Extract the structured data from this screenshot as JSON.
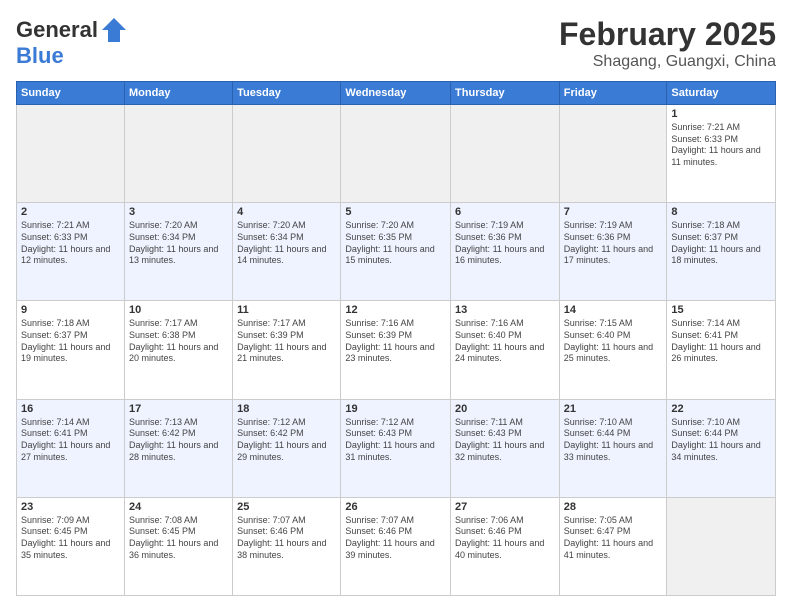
{
  "header": {
    "logo_line1": "General",
    "logo_line2": "Blue",
    "month_title": "February 2025",
    "subtitle": "Shagang, Guangxi, China"
  },
  "weekdays": [
    "Sunday",
    "Monday",
    "Tuesday",
    "Wednesday",
    "Thursday",
    "Friday",
    "Saturday"
  ],
  "weeks": [
    [
      {
        "day": "",
        "info": ""
      },
      {
        "day": "",
        "info": ""
      },
      {
        "day": "",
        "info": ""
      },
      {
        "day": "",
        "info": ""
      },
      {
        "day": "",
        "info": ""
      },
      {
        "day": "",
        "info": ""
      },
      {
        "day": "1",
        "info": "Sunrise: 7:21 AM\nSunset: 6:33 PM\nDaylight: 11 hours and 11 minutes."
      }
    ],
    [
      {
        "day": "2",
        "info": "Sunrise: 7:21 AM\nSunset: 6:33 PM\nDaylight: 11 hours and 12 minutes."
      },
      {
        "day": "3",
        "info": "Sunrise: 7:20 AM\nSunset: 6:34 PM\nDaylight: 11 hours and 13 minutes."
      },
      {
        "day": "4",
        "info": "Sunrise: 7:20 AM\nSunset: 6:34 PM\nDaylight: 11 hours and 14 minutes."
      },
      {
        "day": "5",
        "info": "Sunrise: 7:20 AM\nSunset: 6:35 PM\nDaylight: 11 hours and 15 minutes."
      },
      {
        "day": "6",
        "info": "Sunrise: 7:19 AM\nSunset: 6:36 PM\nDaylight: 11 hours and 16 minutes."
      },
      {
        "day": "7",
        "info": "Sunrise: 7:19 AM\nSunset: 6:36 PM\nDaylight: 11 hours and 17 minutes."
      },
      {
        "day": "8",
        "info": "Sunrise: 7:18 AM\nSunset: 6:37 PM\nDaylight: 11 hours and 18 minutes."
      }
    ],
    [
      {
        "day": "9",
        "info": "Sunrise: 7:18 AM\nSunset: 6:37 PM\nDaylight: 11 hours and 19 minutes."
      },
      {
        "day": "10",
        "info": "Sunrise: 7:17 AM\nSunset: 6:38 PM\nDaylight: 11 hours and 20 minutes."
      },
      {
        "day": "11",
        "info": "Sunrise: 7:17 AM\nSunset: 6:39 PM\nDaylight: 11 hours and 21 minutes."
      },
      {
        "day": "12",
        "info": "Sunrise: 7:16 AM\nSunset: 6:39 PM\nDaylight: 11 hours and 23 minutes."
      },
      {
        "day": "13",
        "info": "Sunrise: 7:16 AM\nSunset: 6:40 PM\nDaylight: 11 hours and 24 minutes."
      },
      {
        "day": "14",
        "info": "Sunrise: 7:15 AM\nSunset: 6:40 PM\nDaylight: 11 hours and 25 minutes."
      },
      {
        "day": "15",
        "info": "Sunrise: 7:14 AM\nSunset: 6:41 PM\nDaylight: 11 hours and 26 minutes."
      }
    ],
    [
      {
        "day": "16",
        "info": "Sunrise: 7:14 AM\nSunset: 6:41 PM\nDaylight: 11 hours and 27 minutes."
      },
      {
        "day": "17",
        "info": "Sunrise: 7:13 AM\nSunset: 6:42 PM\nDaylight: 11 hours and 28 minutes."
      },
      {
        "day": "18",
        "info": "Sunrise: 7:12 AM\nSunset: 6:42 PM\nDaylight: 11 hours and 29 minutes."
      },
      {
        "day": "19",
        "info": "Sunrise: 7:12 AM\nSunset: 6:43 PM\nDaylight: 11 hours and 31 minutes."
      },
      {
        "day": "20",
        "info": "Sunrise: 7:11 AM\nSunset: 6:43 PM\nDaylight: 11 hours and 32 minutes."
      },
      {
        "day": "21",
        "info": "Sunrise: 7:10 AM\nSunset: 6:44 PM\nDaylight: 11 hours and 33 minutes."
      },
      {
        "day": "22",
        "info": "Sunrise: 7:10 AM\nSunset: 6:44 PM\nDaylight: 11 hours and 34 minutes."
      }
    ],
    [
      {
        "day": "23",
        "info": "Sunrise: 7:09 AM\nSunset: 6:45 PM\nDaylight: 11 hours and 35 minutes."
      },
      {
        "day": "24",
        "info": "Sunrise: 7:08 AM\nSunset: 6:45 PM\nDaylight: 11 hours and 36 minutes."
      },
      {
        "day": "25",
        "info": "Sunrise: 7:07 AM\nSunset: 6:46 PM\nDaylight: 11 hours and 38 minutes."
      },
      {
        "day": "26",
        "info": "Sunrise: 7:07 AM\nSunset: 6:46 PM\nDaylight: 11 hours and 39 minutes."
      },
      {
        "day": "27",
        "info": "Sunrise: 7:06 AM\nSunset: 6:46 PM\nDaylight: 11 hours and 40 minutes."
      },
      {
        "day": "28",
        "info": "Sunrise: 7:05 AM\nSunset: 6:47 PM\nDaylight: 11 hours and 41 minutes."
      },
      {
        "day": "",
        "info": ""
      }
    ]
  ]
}
